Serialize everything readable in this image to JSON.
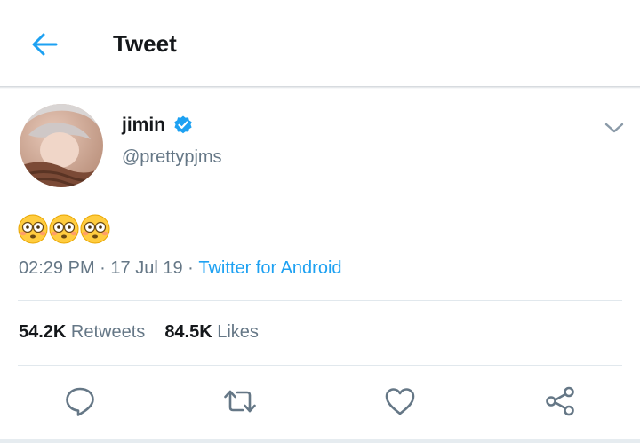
{
  "header": {
    "title": "Tweet"
  },
  "tweet": {
    "author_name": "jimin",
    "author_handle": "@prettypjms",
    "verified": true,
    "content_emoji": [
      "flushed-face-emoji",
      "flushed-face-emoji",
      "flushed-face-emoji"
    ],
    "time": "02:29 PM",
    "separator_1": " · ",
    "date": "17 Jul 19",
    "separator_2": " · ",
    "source": "Twitter for Android"
  },
  "stats": {
    "retweets_count": "54.2K",
    "retweets_label": " Retweets",
    "likes_count": "84.5K",
    "likes_label": " Likes"
  },
  "actions": [
    {
      "name": "reply",
      "icon": "speech-bubble-icon"
    },
    {
      "name": "retweet",
      "icon": "retweet-icon"
    },
    {
      "name": "like",
      "icon": "heart-icon"
    },
    {
      "name": "share",
      "icon": "share-icon"
    }
  ],
  "colors": {
    "accent": "#1da1f2",
    "text_primary": "#14171a",
    "text_secondary": "#657786",
    "divider": "#e1e8ed",
    "icon": "#657786"
  }
}
